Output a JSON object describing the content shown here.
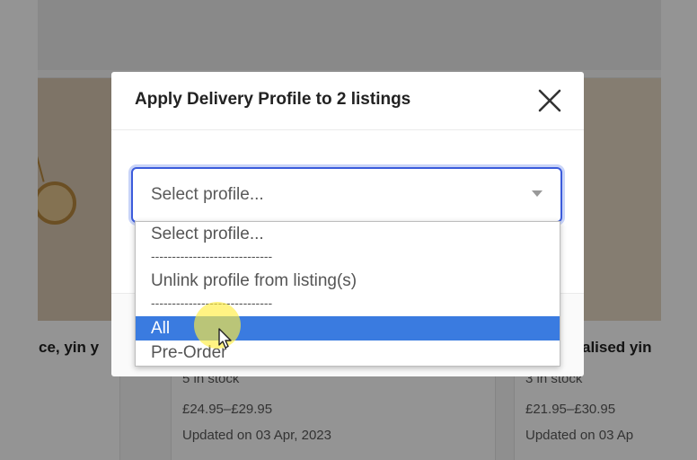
{
  "modal": {
    "title": "Apply Delivery Profile to 2 listings",
    "select": {
      "value": "Select profile...",
      "options": [
        {
          "label": "Select profile..."
        },
        {
          "label": "-----------------------------"
        },
        {
          "label": "Unlink profile from listing(s)"
        },
        {
          "label": "-----------------------------"
        },
        {
          "label": "All",
          "selected": true
        },
        {
          "label": "Pre-Order"
        }
      ]
    }
  },
  "listings": [
    {
      "title": "ce, yin y"
    },
    {
      "stock": "5 in stock",
      "price": "£24.95–£29.95",
      "updated": "Updated on 03 Apr, 2023"
    },
    {
      "title": "alised yin",
      "stock": "3 in stock",
      "price": "£21.95–£30.95",
      "updated": "Updated on 03 Ap"
    }
  ],
  "colors": {
    "selected_option": "#3a7be0",
    "select_focus": "#3b5bdb"
  },
  "icons": [
    "close-icon",
    "caret-down-icon",
    "pointer-cursor-icon"
  ]
}
